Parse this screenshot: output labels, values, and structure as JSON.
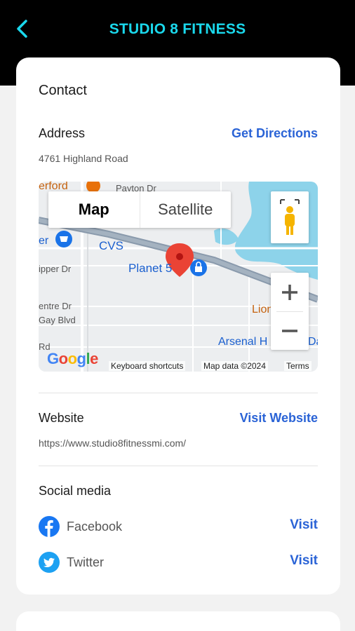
{
  "header": {
    "title": "STUDIO 8 FITNESS",
    "back_icon": "chevron-left-icon",
    "bg": "#000000",
    "accent": "#1ad8ec"
  },
  "contact": {
    "heading": "Contact",
    "address_label": "Address",
    "directions_label": "Get Directions",
    "address": "4761 Highland Road"
  },
  "map": {
    "type_map": "Map",
    "type_satellite": "Satellite",
    "labels": {
      "erford": "erford",
      "payton": "Payton Dr",
      "cvs": "CVS",
      "planet": "Planet 5",
      "pipper": "ipper Dr",
      "centre": "entre Dr",
      "gay": "Gay Blvd",
      "rd": "Rd",
      "lion": "Lion",
      "arsenal": "Arsenal H",
      "da": "Da",
      "er": "er"
    },
    "google_logo": "Google",
    "keyboard": "Keyboard shortcuts",
    "map_data": "Map data ©2024",
    "terms": "Terms"
  },
  "website": {
    "label": "Website",
    "visit_label": "Visit Website",
    "url": "https://www.studio8fitnessmi.com/"
  },
  "social": {
    "heading": "Social media",
    "items": [
      {
        "name": "Facebook",
        "icon": "facebook-icon",
        "visit": "Visit",
        "color": "#1877f2"
      },
      {
        "name": "Twitter",
        "icon": "twitter-icon",
        "visit": "Visit",
        "color": "#1da1f2"
      }
    ]
  }
}
